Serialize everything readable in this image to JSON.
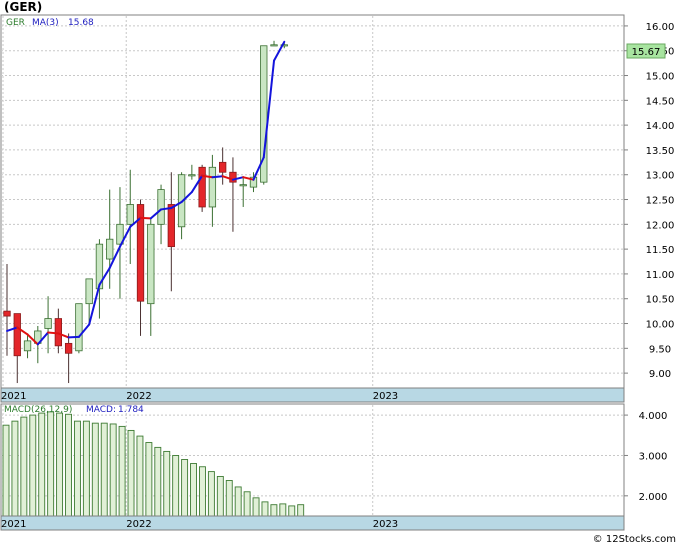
{
  "title": "(GER)",
  "watermark": "© 12Stocks.com",
  "colors": {
    "up_candle": "#c9e6c3",
    "down_candle": "#e3262a",
    "candle_outline": "#3a6f31",
    "ma_up": "#1414dc",
    "ma_down": "#e01010",
    "macd_bar": "#e1f0d7",
    "macd_outline": "#3d7a32",
    "axis_band": "#b8d8e4",
    "grid": "#c8c8c8",
    "last_price_box": "#a8e4a0"
  },
  "chart_data": [
    {
      "type": "candlestick",
      "legend": {
        "ticker": "GER",
        "ma_label": "MA(3)",
        "ma_value": "15.68"
      },
      "last_price_label": "15.67",
      "y_ticks": [
        "16.00",
        "15.50",
        "15.00",
        "14.50",
        "14.00",
        "13.50",
        "13.00",
        "12.50",
        "12.00",
        "11.50",
        "11.00",
        "10.50",
        "10.00",
        "9.50",
        "9.00"
      ],
      "ylim": [
        8.7,
        16.2
      ],
      "x_labels": [
        {
          "label": "2021",
          "index": 0
        },
        {
          "label": "2022",
          "index": 12
        },
        {
          "label": "2023",
          "index": 36
        }
      ],
      "candles": [
        {
          "o": 10.25,
          "h": 11.2,
          "l": 9.35,
          "c": 10.15
        },
        {
          "o": 10.2,
          "h": 10.2,
          "l": 8.8,
          "c": 9.35
        },
        {
          "o": 9.45,
          "h": 9.8,
          "l": 9.3,
          "c": 9.65
        },
        {
          "o": 9.6,
          "h": 9.95,
          "l": 9.2,
          "c": 9.85
        },
        {
          "o": 9.9,
          "h": 10.55,
          "l": 9.4,
          "c": 10.1
        },
        {
          "o": 10.1,
          "h": 10.3,
          "l": 9.4,
          "c": 9.55
        },
        {
          "o": 9.6,
          "h": 9.8,
          "l": 8.8,
          "c": 9.4
        },
        {
          "o": 9.45,
          "h": 10.4,
          "l": 9.4,
          "c": 10.4
        },
        {
          "o": 10.4,
          "h": 10.9,
          "l": 10.0,
          "c": 10.9
        },
        {
          "o": 10.7,
          "h": 11.7,
          "l": 10.1,
          "c": 11.6
        },
        {
          "o": 11.3,
          "h": 12.7,
          "l": 10.7,
          "c": 11.7
        },
        {
          "o": 11.6,
          "h": 12.75,
          "l": 10.5,
          "c": 12.0
        },
        {
          "o": 12.0,
          "h": 13.1,
          "l": 11.2,
          "c": 12.4
        },
        {
          "o": 12.4,
          "h": 12.5,
          "l": 9.75,
          "c": 10.45
        },
        {
          "o": 10.4,
          "h": 12.1,
          "l": 9.75,
          "c": 12.0
        },
        {
          "o": 12.0,
          "h": 12.8,
          "l": 11.6,
          "c": 12.7
        },
        {
          "o": 12.4,
          "h": 13.05,
          "l": 10.65,
          "c": 11.55
        },
        {
          "o": 11.95,
          "h": 13.05,
          "l": 11.7,
          "c": 13.0
        },
        {
          "o": 13.0,
          "h": 13.2,
          "l": 12.9,
          "c": 13.0
        },
        {
          "o": 13.15,
          "h": 13.2,
          "l": 12.25,
          "c": 12.35
        },
        {
          "o": 12.35,
          "h": 13.4,
          "l": 11.95,
          "c": 13.15
        },
        {
          "o": 13.25,
          "h": 13.55,
          "l": 12.8,
          "c": 13.05
        },
        {
          "o": 13.05,
          "h": 13.35,
          "l": 11.85,
          "c": 12.85
        },
        {
          "o": 12.8,
          "h": 12.95,
          "l": 12.35,
          "c": 12.8
        },
        {
          "o": 12.75,
          "h": 13.05,
          "l": 12.65,
          "c": 12.95
        },
        {
          "o": 12.85,
          "h": 15.6,
          "l": 12.8,
          "c": 15.6
        },
        {
          "o": 15.62,
          "h": 15.7,
          "l": 15.62,
          "c": 15.62
        },
        {
          "o": 15.62,
          "h": 15.68,
          "l": 15.55,
          "c": 15.62
        }
      ],
      "ma": [
        9.85,
        9.92,
        9.78,
        9.58,
        9.82,
        9.8,
        9.72,
        9.73,
        9.98,
        10.78,
        11.12,
        11.55,
        11.95,
        12.13,
        12.12,
        12.3,
        12.33,
        12.45,
        12.65,
        12.98,
        12.95,
        12.97,
        12.9,
        12.95,
        12.9,
        13.35,
        15.3,
        15.68
      ]
    },
    {
      "type": "bar",
      "legend": {
        "name": "MACD(26,12,9)",
        "label": "MACD:",
        "value": "1.784"
      },
      "y_ticks": [
        "4.000",
        "3.000",
        "2.000"
      ],
      "ylim": [
        1.5,
        4.25
      ],
      "x_labels": [
        {
          "label": "2021",
          "index": 0
        },
        {
          "label": "2022",
          "index": 12
        },
        {
          "label": "2023",
          "index": 36
        }
      ],
      "values": [
        3.75,
        3.85,
        3.95,
        4.0,
        4.05,
        4.08,
        4.05,
        4.02,
        3.85,
        3.85,
        3.8,
        3.8,
        3.78,
        3.72,
        3.62,
        3.48,
        3.32,
        3.2,
        3.1,
        3.0,
        2.9,
        2.8,
        2.72,
        2.6,
        2.48,
        2.38,
        2.22,
        2.1,
        1.95,
        1.85,
        1.78,
        1.8,
        1.75,
        1.78
      ]
    }
  ]
}
